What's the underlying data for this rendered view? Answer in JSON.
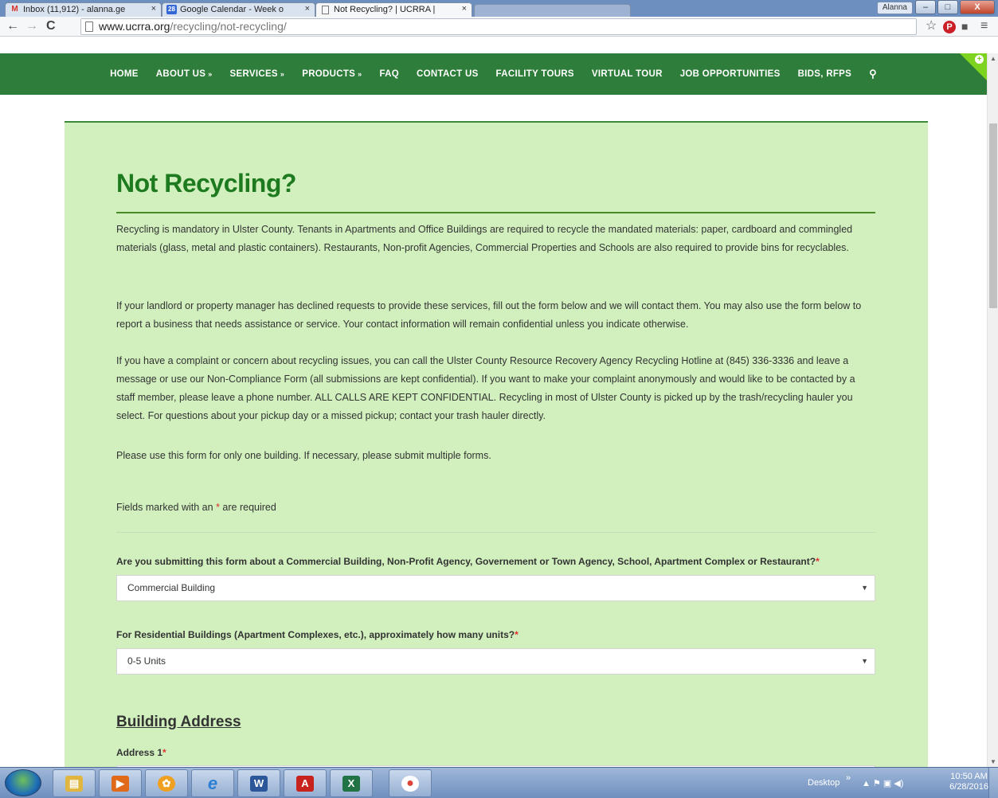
{
  "browser": {
    "tabs": [
      {
        "icon_glyph": "M",
        "icon_color": "#d93025",
        "title": "Inbox (11,912) - alanna.ge"
      },
      {
        "icon_glyph": "28",
        "icon_color": "#3367d6",
        "title": "Google Calendar - Week o"
      },
      {
        "icon_glyph": "",
        "icon_color": "#777777",
        "title": "Not Recycling? | UCRRA | "
      }
    ],
    "tab_close_glyph": "×",
    "user_badge": "Alanna",
    "window_buttons": {
      "minimize": "–",
      "maximize": "□",
      "close": "X"
    },
    "nav": {
      "back": "←",
      "forward": "→",
      "reload": "C"
    },
    "url_host": "www.ucrra.org",
    "url_path": "/recycling/not-recycling/",
    "toolbar_icons": {
      "star": "☆",
      "pinterest": "P",
      "extension": "■",
      "menu": "≡"
    }
  },
  "site_nav": {
    "items": [
      {
        "label": "HOME",
        "has_chevron": false
      },
      {
        "label": "ABOUT US",
        "has_chevron": true
      },
      {
        "label": "SERVICES",
        "has_chevron": true
      },
      {
        "label": "PRODUCTS",
        "has_chevron": true
      },
      {
        "label": "FAQ",
        "has_chevron": false
      },
      {
        "label": "CONTACT US",
        "has_chevron": false
      },
      {
        "label": "FACILITY TOURS",
        "has_chevron": false
      },
      {
        "label": "VIRTUAL TOUR",
        "has_chevron": false
      },
      {
        "label": "JOB OPPORTUNITIES",
        "has_chevron": false
      },
      {
        "label": "BIDS, RFPS",
        "has_chevron": false
      }
    ],
    "chevron_glyph": "»",
    "search_glyph": "⚲",
    "ribbon_glyph": "+"
  },
  "page": {
    "title": "Not Recycling?",
    "paragraphs": [
      "Recycling is mandatory in Ulster County. Tenants in Apartments and Office Buildings are required to recycle the mandated materials: paper, cardboard and commingled materials (glass, metal and plastic containers). Restaurants, Non-profit Agencies, Commercial Properties and Schools are also required to provide bins for recyclables.",
      "If your landlord or property manager has declined requests to provide these services, fill out the form below and we will contact them. You may also use the form below to report a business that needs assistance or service. Your contact information will remain confidential unless you indicate otherwise.",
      "If you have a complaint or concern about recycling issues, you can call the Ulster County Resource Recovery Agency Recycling Hotline at (845) 336-3336 and leave a message or use our Non-Compliance Form (all submissions are kept confidential). If you want to make your complaint anonymously and would like to be contacted by a staff member, please leave a phone number. ALL CALLS ARE KEPT CONFIDENTIAL. Recycling in most of Ulster County is picked up by the trash/recycling hauler you select. For questions about your pickup day or a missed pickup; contact your trash hauler directly.",
      "Please use this form for only one building. If necessary, please submit multiple forms."
    ],
    "required_note_prefix": "Fields marked with an ",
    "required_star": "*",
    "required_note_suffix": " are required",
    "form": {
      "q1_label": "Are you submitting this form about a Commercial Building, Non-Profit Agency, Governement or Town Agency, School, Apartment Complex or Restaurant?",
      "q1_value": "Commercial Building",
      "q2_label": "For Residential Buildings (Apartment Complexes, etc.), approximately how many units?",
      "q2_value": "0-5 Units",
      "section_title": "Building Address",
      "address1_label": "Address 1",
      "caret_glyph": "▼"
    }
  },
  "scrollbar": {
    "up": "▲",
    "down": "▼"
  },
  "taskbar": {
    "apps": [
      {
        "name": "file-explorer",
        "glyph": "▤",
        "color": "#e0b640"
      },
      {
        "name": "media-player",
        "glyph": "▶",
        "color": "#e06a1a"
      },
      {
        "name": "photo-app",
        "glyph": "✿",
        "color": "#f0a020"
      },
      {
        "name": "internet-explorer",
        "glyph": "e",
        "color": "#2a7fd4"
      },
      {
        "name": "word",
        "glyph": "W",
        "color": "#2b579a"
      },
      {
        "name": "acrobat",
        "glyph": "A",
        "color": "#c8221c"
      },
      {
        "name": "excel",
        "glyph": "X",
        "color": "#217346"
      },
      {
        "name": "chrome",
        "glyph": "●",
        "color": "#db4437"
      }
    ],
    "desktop_label": "Desktop",
    "tray_chevron": "»",
    "tray_icons": "▲ ⚑ ▣ ◀)",
    "clock_time": "10:50 AM",
    "clock_date": "6/28/2016"
  }
}
